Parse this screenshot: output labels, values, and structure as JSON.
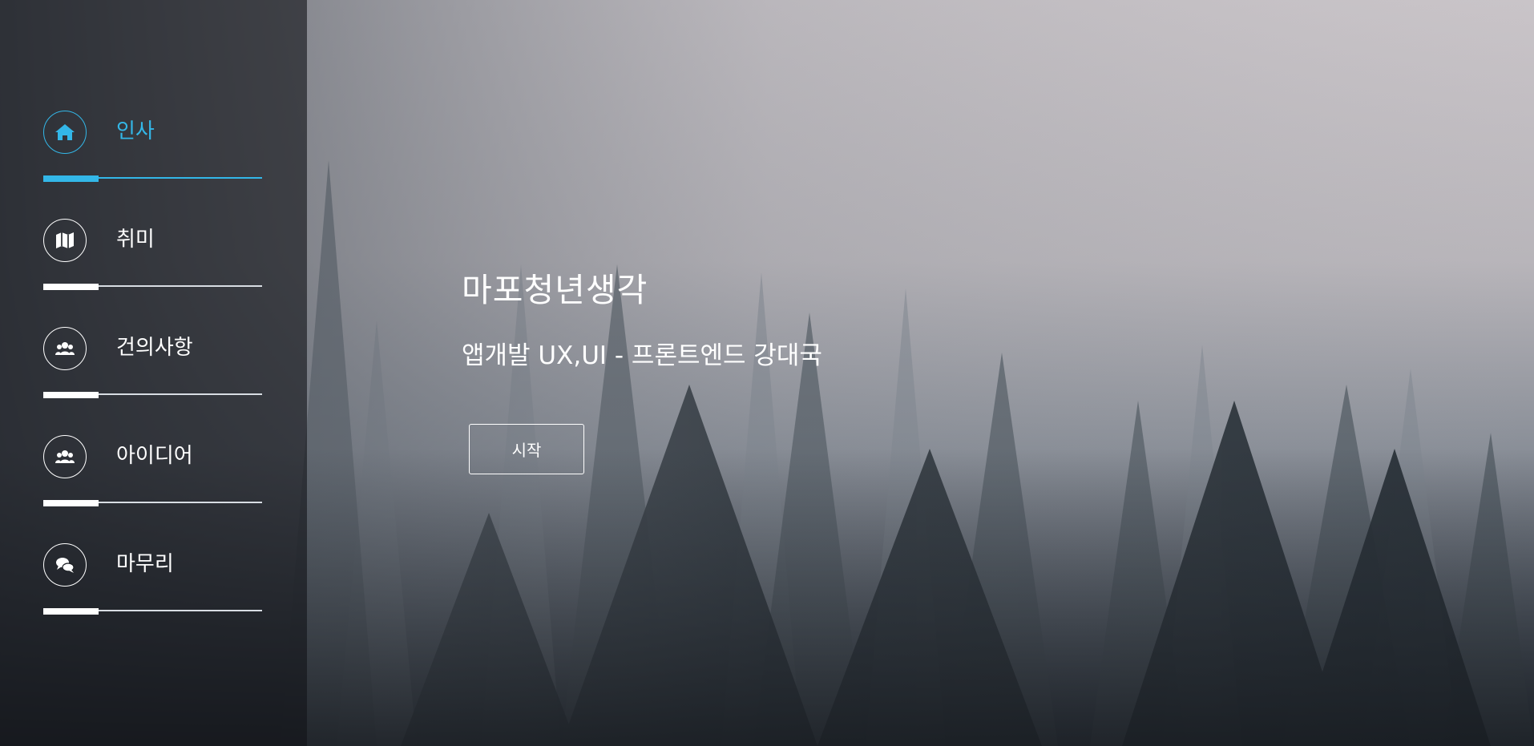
{
  "background": {
    "description_icon": "foggy-forest-image"
  },
  "sidebar": {
    "accent_color": "#33b7e8",
    "items": [
      {
        "label": "인사",
        "icon": "home-icon",
        "active": true
      },
      {
        "label": "취미",
        "icon": "map-icon",
        "active": false
      },
      {
        "label": "건의사항",
        "icon": "users-icon",
        "active": false
      },
      {
        "label": "아이디어",
        "icon": "users-icon",
        "active": false
      },
      {
        "label": "마무리",
        "icon": "comments-icon",
        "active": false
      }
    ]
  },
  "hero": {
    "title": "마포청년생각",
    "subtitle": "앱개발 UX,UI - 프론트엔드 강대국",
    "start_label": "시작"
  }
}
